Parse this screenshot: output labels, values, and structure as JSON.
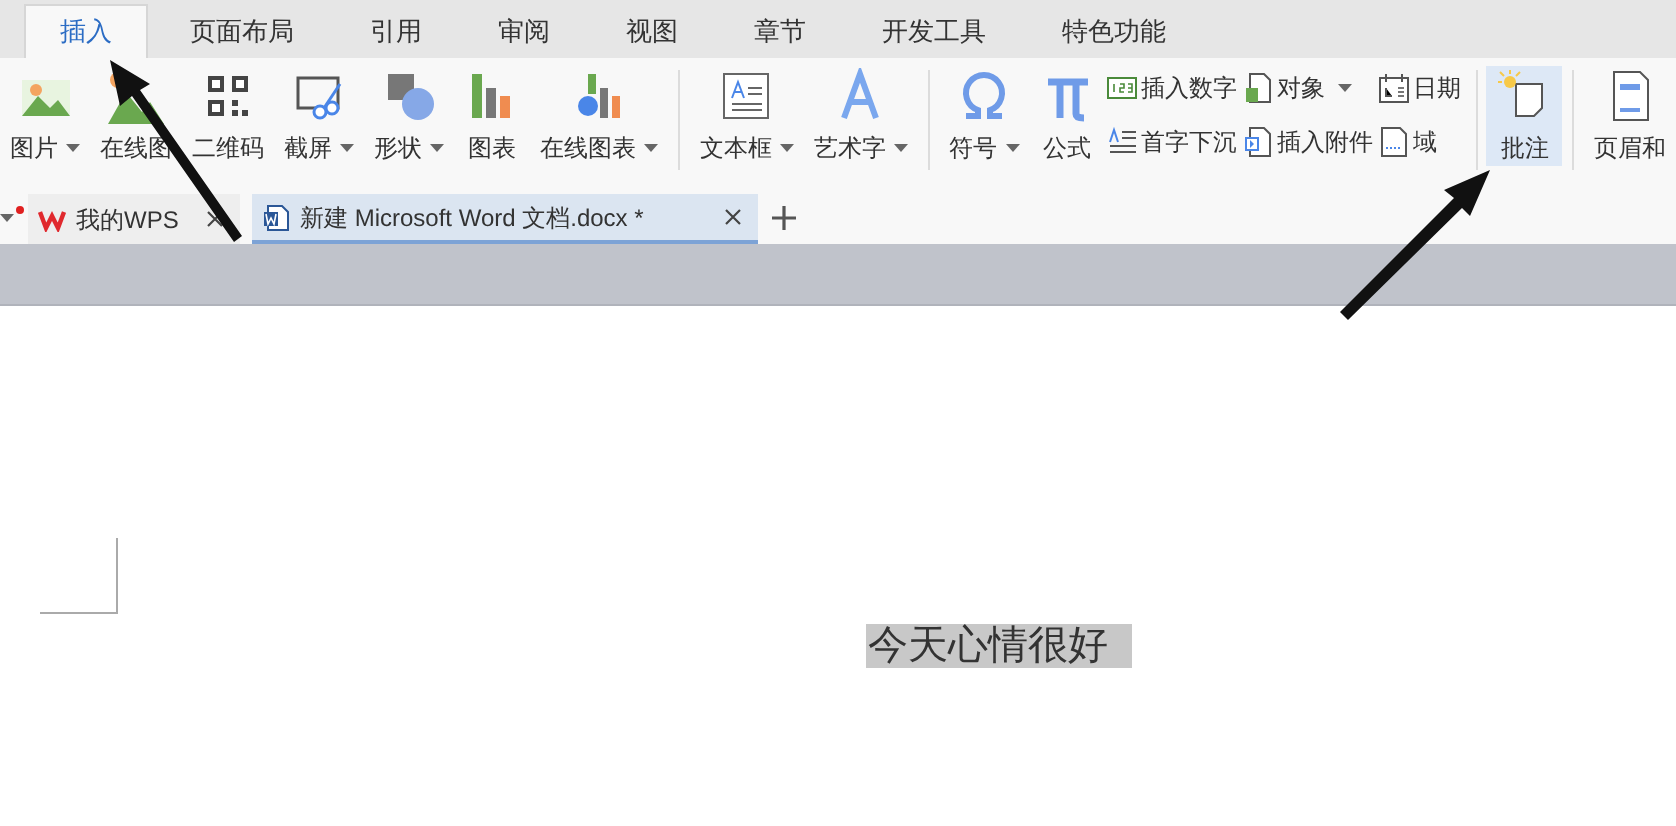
{
  "menu_tabs": [
    {
      "label": "插入",
      "selected": true
    },
    {
      "label": "页面布局",
      "selected": false
    },
    {
      "label": "引用",
      "selected": false
    },
    {
      "label": "审阅",
      "selected": false
    },
    {
      "label": "视图",
      "selected": false
    },
    {
      "label": "章节",
      "selected": false
    },
    {
      "label": "开发工具",
      "selected": false
    },
    {
      "label": "特色功能",
      "selected": false
    }
  ],
  "ribbon": [
    {
      "kind": "big",
      "label": "图片",
      "dropdown": true,
      "selected": false
    },
    {
      "kind": "big",
      "label": "在线图",
      "dropdown": false,
      "selected": false
    },
    {
      "kind": "big",
      "label": "二维码",
      "dropdown": false,
      "selected": false
    },
    {
      "kind": "big",
      "label": "截屏",
      "dropdown": true,
      "selected": false
    },
    {
      "kind": "big",
      "label": "形状",
      "dropdown": true,
      "selected": false
    },
    {
      "kind": "big",
      "label": "图表",
      "dropdown": false,
      "selected": false
    },
    {
      "kind": "big",
      "label": "在线图表",
      "dropdown": true,
      "selected": false
    },
    {
      "kind": "separator"
    },
    {
      "kind": "big",
      "label": "文本框",
      "dropdown": true,
      "selected": false
    },
    {
      "kind": "big",
      "label": "艺术字",
      "dropdown": true,
      "selected": false
    },
    {
      "kind": "separator"
    },
    {
      "kind": "big",
      "label": "符号",
      "dropdown": true,
      "selected": false
    },
    {
      "kind": "big",
      "label": "公式",
      "dropdown": false,
      "selected": false
    },
    {
      "kind": "small",
      "items": [
        {
          "label": "插入数字",
          "dropdown": false
        },
        {
          "label": "首字下沉",
          "dropdown": false
        }
      ]
    },
    {
      "kind": "small",
      "items": [
        {
          "label": "对象",
          "dropdown": true
        },
        {
          "label": "插入附件",
          "dropdown": false
        }
      ]
    },
    {
      "kind": "small",
      "items": [
        {
          "label": "日期",
          "dropdown": false
        },
        {
          "label": "域",
          "dropdown": false
        }
      ]
    },
    {
      "kind": "separator"
    },
    {
      "kind": "big",
      "label": "批注",
      "dropdown": false,
      "selected": true
    },
    {
      "kind": "separator"
    },
    {
      "kind": "big",
      "label": "页眉和",
      "dropdown": false,
      "selected": false
    }
  ],
  "doc_tabs": [
    {
      "label": "我的WPS",
      "selected": false
    },
    {
      "label": "新建 Microsoft Word 文档.docx *",
      "selected": true
    }
  ],
  "document": {
    "text": "今天心情很好",
    "highlighted": true
  }
}
